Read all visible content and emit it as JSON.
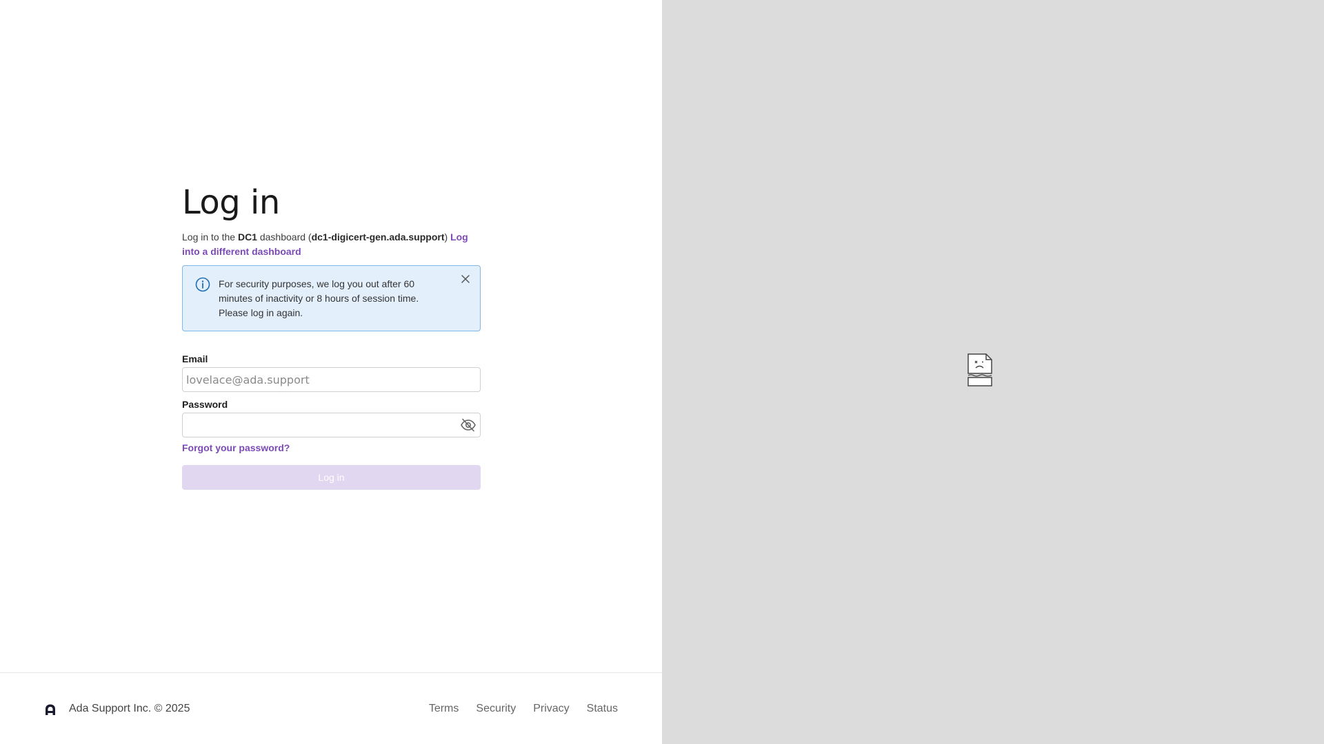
{
  "login": {
    "title": "Log in",
    "subtitle_prefix": "Log in to the ",
    "dashboard_name": "DC1",
    "subtitle_middle": " dashboard (",
    "dashboard_host": "dc1-digicert-gen.ada.support",
    "subtitle_suffix": ") ",
    "different_dashboard_link": "Log into a different dashboard",
    "alert_text": "For security purposes, we log you out after 60 minutes of inactivity or 8 hours of session time. Please log in again.",
    "email_label": "Email",
    "email_placeholder": "lovelace@ada.support",
    "email_value": "",
    "password_label": "Password",
    "password_value": "",
    "forgot_password_link": "Forgot your password?",
    "login_button": "Log in"
  },
  "footer": {
    "copyright": "Ada Support Inc. © 2025",
    "links": [
      "Terms",
      "Security",
      "Privacy",
      "Status"
    ]
  },
  "colors": {
    "link_purple": "#7b4ab6",
    "alert_bg": "#e3effb",
    "alert_border": "#7eb7e8",
    "button_disabled": "#e2d7f0",
    "right_panel": "#dcdcdc"
  },
  "icons": {
    "alert": "info-icon",
    "dismiss": "close-icon",
    "password_toggle": "eye-off-icon",
    "logo": "ada-logo-icon",
    "image_placeholder": "broken-image-icon"
  }
}
